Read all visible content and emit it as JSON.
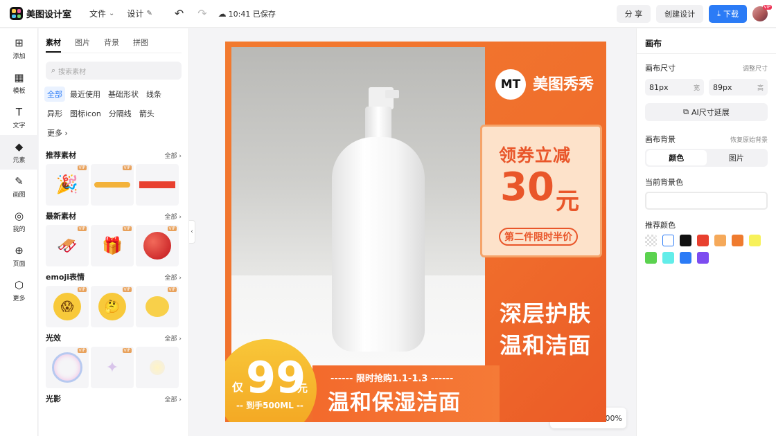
{
  "app": {
    "name": "美图设计室"
  },
  "menu": {
    "file": "文件",
    "design": "设计",
    "save_status": "10:41 已保存"
  },
  "actions": {
    "share": "分 享",
    "create_design": "创建设计",
    "download": "下载",
    "avatar_badge": "VIP"
  },
  "rail": [
    {
      "label": "添加",
      "icon": "plus-square-icon",
      "glyph": "⊞"
    },
    {
      "label": "模板",
      "icon": "template-icon",
      "glyph": "▦"
    },
    {
      "label": "文字",
      "icon": "text-icon",
      "glyph": "T"
    },
    {
      "label": "元素",
      "icon": "elements-icon",
      "glyph": "◆"
    },
    {
      "label": "画图",
      "icon": "draw-icon",
      "glyph": "✎"
    },
    {
      "label": "我的",
      "icon": "user-icon",
      "glyph": "◎"
    },
    {
      "label": "页面",
      "icon": "page-add-icon",
      "glyph": "⊕"
    },
    {
      "label": "更多",
      "icon": "more-cube-icon",
      "glyph": "⬡"
    }
  ],
  "panel": {
    "tabs": [
      "素材",
      "图片",
      "背景",
      "拼图"
    ],
    "search_placeholder": "搜索素材",
    "chips": [
      "全部",
      "最近使用",
      "基础形状",
      "线条",
      "异形",
      "图标icon",
      "分隔线",
      "箭头",
      "更多"
    ],
    "sections": [
      {
        "title": "推荐素材",
        "all": "全部"
      },
      {
        "title": "最新素材",
        "all": "全部"
      },
      {
        "title": "emoji表情",
        "all": "全部"
      },
      {
        "title": "光效",
        "all": "全部"
      },
      {
        "title": "光影",
        "all": "全部"
      }
    ],
    "vip_badge": "VIP"
  },
  "canvas": {
    "brand_logo": "MT",
    "brand_name": "美图秀秀",
    "coupon_title": "领券立减",
    "coupon_amount": "30",
    "coupon_unit": "元",
    "coupon_note": "第二件限时半价",
    "headline_line1": "深层护肤",
    "headline_line2": "温和洁面",
    "price_prefix": "仅",
    "price_value": "99",
    "price_unit": "元",
    "price_sub": "-- 到手500ML --",
    "banner_top": "------ 限时抢购1.1-1.3 ------",
    "banner_main": "温和保湿洁面",
    "zoom": "00%"
  },
  "props": {
    "title": "画布",
    "size_label": "画布尺寸",
    "resize_link": "调整尺寸",
    "width_value": "81px",
    "width_unit": "宽",
    "height_value": "89px",
    "height_unit": "高",
    "ai_extend": "AI尺寸延展",
    "bg_label": "画布背景",
    "restore_bg": "恢复原始背景",
    "seg_color": "颜色",
    "seg_image": "图片",
    "current_bg": "当前背景色",
    "recommended": "推荐颜色",
    "swatch_colors": [
      "transparent",
      "#ffffff",
      "#111111",
      "#e8402f",
      "#f5a95a",
      "#ef7b2f",
      "#f7f15a",
      "#5bd24f",
      "#62ede9",
      "#2b7bf6",
      "#7d4cf0"
    ]
  }
}
